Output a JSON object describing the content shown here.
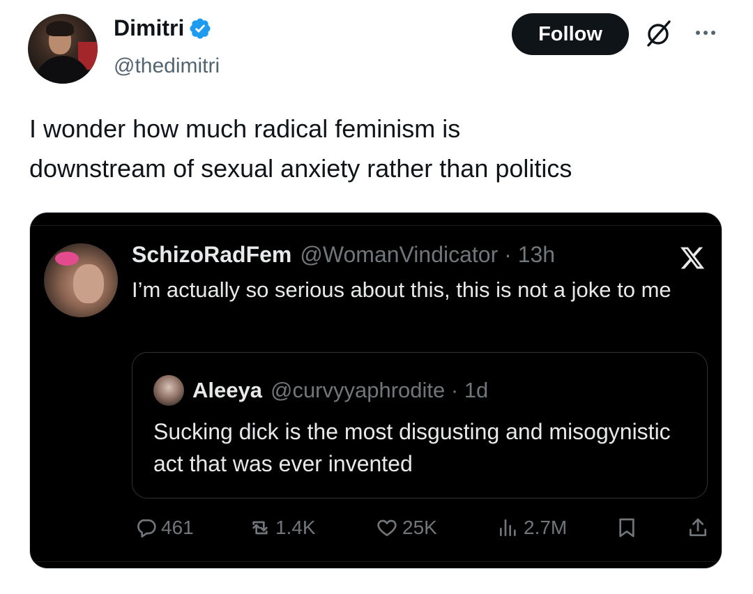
{
  "author": {
    "display_name": "Dimitri",
    "handle": "@thedimitri",
    "verified": true
  },
  "header": {
    "follow_label": "Follow"
  },
  "tweet": {
    "text": "I wonder how much radical feminism is\ndownstream of sexual anxiety rather than politics"
  },
  "embedded": {
    "display_name": "SchizoRadFem",
    "handle_time": "@WomanVindicator · 13h",
    "text": "I’m actually so serious about this, this is not a joke to me",
    "quote": {
      "display_name": "Aleeya",
      "handle_time": "@curvyyaphrodite · 1d",
      "text": "Sucking dick is the most disgusting and misogynistic act that was ever invented"
    },
    "stats": {
      "replies": "461",
      "reposts": "1.4K",
      "likes": "25K",
      "views": "2.7M"
    }
  },
  "colors": {
    "verified_blue": "#1d9bf0",
    "follow_bg": "#0f1419",
    "media_bg": "#000000",
    "muted_text": "#536471"
  },
  "icons": {
    "verified": "verified-badge-icon",
    "grok": "grok-icon",
    "more": "more-icon",
    "x_logo": "x-logo-icon",
    "reply": "reply-icon",
    "repost": "repost-icon",
    "like": "heart-icon",
    "views": "views-icon",
    "bookmark": "bookmark-icon",
    "share": "share-icon"
  }
}
